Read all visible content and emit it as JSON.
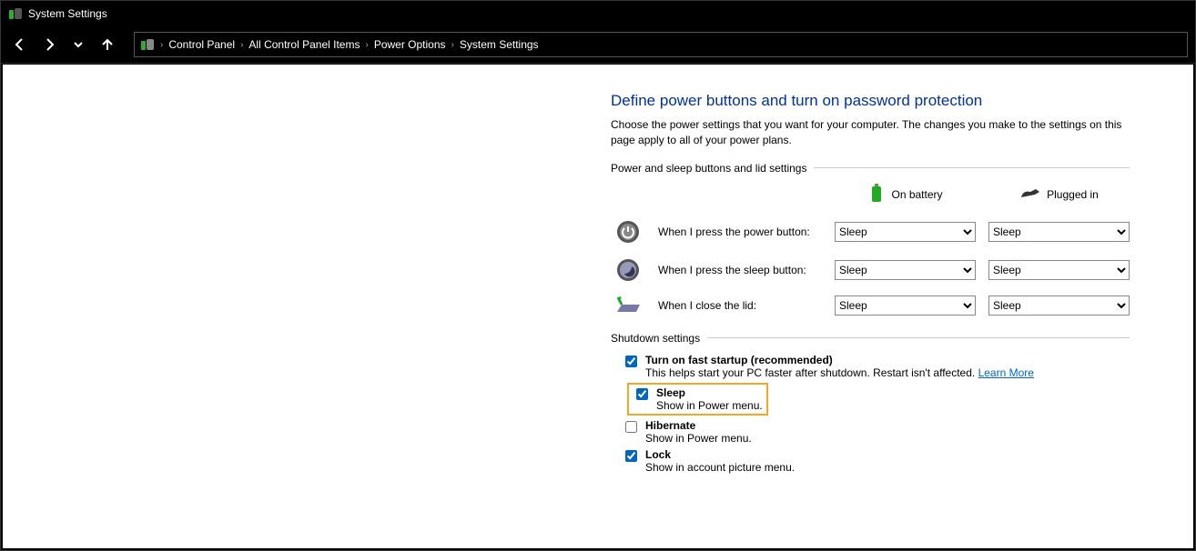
{
  "window": {
    "title": "System Settings"
  },
  "breadcrumb": {
    "items": [
      "Control Panel",
      "All Control Panel Items",
      "Power Options",
      "System Settings"
    ]
  },
  "page": {
    "title": "Define power buttons and turn on password protection",
    "description": "Choose the power settings that you want for your computer. The changes you make to the settings on this page apply to all of your power plans."
  },
  "section_power_sleep": {
    "label": "Power and sleep buttons and lid settings",
    "col_battery": "On battery",
    "col_plugged": "Plugged in",
    "rows": {
      "power_button": {
        "label": "When I press the power button:",
        "battery": "Sleep",
        "plugged": "Sleep"
      },
      "sleep_button": {
        "label": "When I press the sleep button:",
        "battery": "Sleep",
        "plugged": "Sleep"
      },
      "lid": {
        "label": "When I close the lid:",
        "battery": "Sleep",
        "plugged": "Sleep"
      }
    }
  },
  "section_shutdown": {
    "label": "Shutdown settings",
    "fast_startup": {
      "label": "Turn on fast startup (recommended)",
      "desc": "This helps start your PC faster after shutdown. Restart isn't affected. ",
      "link": "Learn More",
      "checked": true
    },
    "sleep": {
      "label": "Sleep",
      "desc": "Show in Power menu.",
      "checked": true
    },
    "hibernate": {
      "label": "Hibernate",
      "desc": "Show in Power menu.",
      "checked": false
    },
    "lock": {
      "label": "Lock",
      "desc": "Show in account picture menu.",
      "checked": true
    }
  }
}
